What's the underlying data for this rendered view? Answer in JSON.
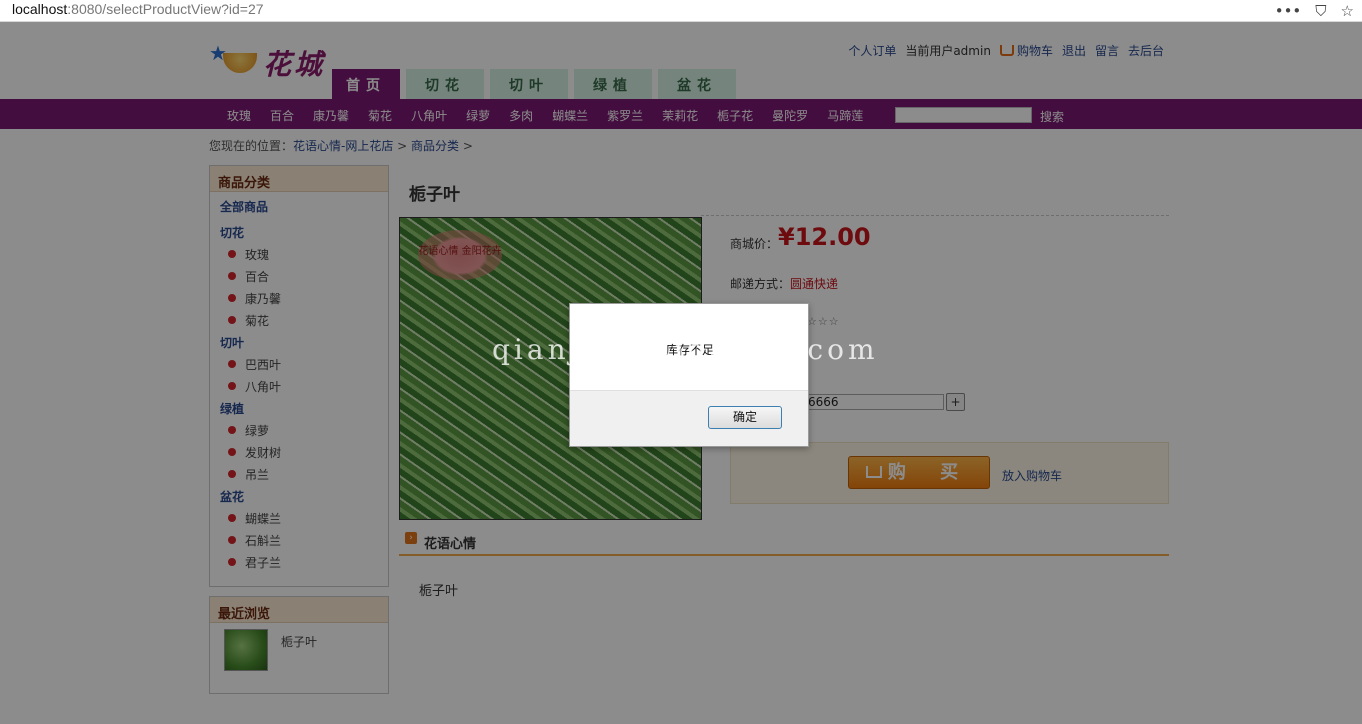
{
  "browser": {
    "url_host": "localhost",
    "url_rest": ":8080/selectProductView?id=27",
    "menu_glyph": "•••",
    "pocket_glyph": "⛉",
    "star_glyph": "☆"
  },
  "header": {
    "logo_text": "花城",
    "links": {
      "orders": "个人订单",
      "current_user": "当前用户admin",
      "cart": "购物车",
      "logout": "退出",
      "message": "留言",
      "backend": "去后台"
    },
    "tabs": [
      "首页",
      "切花",
      "切叶",
      "绿植",
      "盆花"
    ]
  },
  "category_bar": {
    "items": [
      "玫瑰",
      "百合",
      "康乃馨",
      "菊花",
      "八角叶",
      "绿萝",
      "多肉",
      "蝴蝶兰",
      "紫罗兰",
      "茉莉花",
      "栀子花",
      "曼陀罗",
      "马蹄莲"
    ],
    "search_placeholder": "",
    "search_button": "搜索"
  },
  "breadcrumb": {
    "prefix": "您现在的位置：",
    "home": "花语心情-网上花店",
    "sep1": " > ",
    "category": "商品分类",
    "sep2": " >"
  },
  "sidebar": {
    "title": "商品分类",
    "all": "全部商品",
    "groups": [
      {
        "name": "切花",
        "items": [
          "玫瑰",
          "百合",
          "康乃馨",
          "菊花"
        ]
      },
      {
        "name": "切叶",
        "items": [
          "巴西叶",
          "八角叶"
        ]
      },
      {
        "name": "绿植",
        "items": [
          "绿萝",
          "发财树",
          "吊兰"
        ]
      },
      {
        "name": "盆花",
        "items": [
          "蝴蝶兰",
          "石斛兰",
          "君子兰"
        ]
      }
    ]
  },
  "recent": {
    "title": "最近浏览",
    "item_name": "栀子叶"
  },
  "product": {
    "name": "栀子叶",
    "image_stamp": "花语心情 金阳花卉",
    "price_label": "商城价：",
    "price": "¥12.00",
    "shipping_label": "邮递方式：",
    "shipping_value": "圆通快递",
    "rating_stars": "☆☆☆",
    "quantity": "6666",
    "plus_label": "+",
    "buy_label": "购 买",
    "add_to_cart": "放入购物车"
  },
  "section": {
    "title": "花语心情",
    "description": "栀子叶"
  },
  "dialog": {
    "message": "库存不足",
    "ok_label": "确定"
  },
  "watermark": "qianjc@zuidaima.com",
  "colors": {
    "brand_purple": "#7b1a74",
    "price_red": "#c8151c",
    "buy_orange": "#f07d10",
    "link_blue": "#2b4a90"
  }
}
